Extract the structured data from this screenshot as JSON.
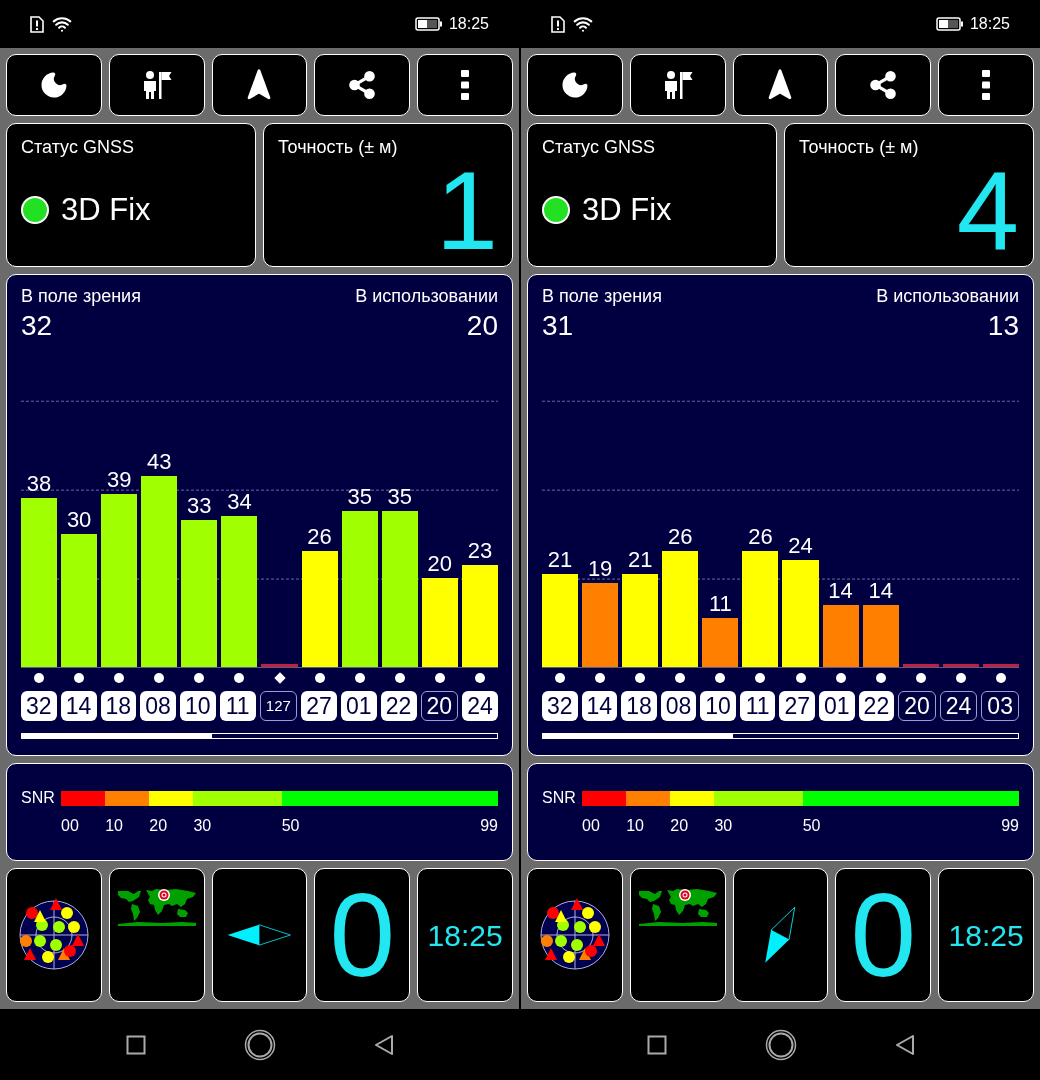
{
  "screens": [
    {
      "status_bar": {
        "time": "18:25"
      },
      "gnss_status": {
        "label": "Статус GNSS",
        "value": "3D Fix"
      },
      "accuracy": {
        "label": "Точность (± м)",
        "value": "1"
      },
      "satellites": {
        "in_view_label": "В поле зрения",
        "in_view": "32",
        "in_use_label": "В использовании",
        "in_use": "20",
        "chart_data": {
          "type": "bar",
          "categories": [
            "32",
            "14",
            "18",
            "08",
            "10",
            "11",
            "127",
            "27",
            "01",
            "22",
            "20",
            "24"
          ],
          "values": [
            38,
            30,
            39,
            43,
            33,
            34,
            0,
            26,
            35,
            35,
            20,
            23
          ],
          "value_labels": [
            "38",
            "30",
            "39",
            "43",
            "33",
            "34",
            null,
            "26",
            "35",
            "35",
            "20",
            "23"
          ]
        },
        "markers": [
          {
            "kind": "dot",
            "used": true
          },
          {
            "kind": "dot",
            "used": true
          },
          {
            "kind": "dot",
            "used": true
          },
          {
            "kind": "dot",
            "used": true
          },
          {
            "kind": "dot",
            "used": true
          },
          {
            "kind": "dot",
            "used": true
          },
          {
            "kind": "diamond",
            "used": false
          },
          {
            "kind": "dot",
            "used": true
          },
          {
            "kind": "dot",
            "used": true
          },
          {
            "kind": "dot",
            "used": true
          },
          {
            "kind": "dot",
            "used": false
          },
          {
            "kind": "dot",
            "used": true
          }
        ]
      },
      "snr_legend": {
        "label": "SNR",
        "segments": [
          {
            "color": "#ff0000"
          },
          {
            "color": "#ff8000"
          },
          {
            "color": "#ffff00"
          },
          {
            "color": "#a0ff00"
          },
          {
            "color": "#00ff00"
          }
        ],
        "ticks": [
          "00",
          "10",
          "20",
          "30",
          "50",
          "99"
        ]
      },
      "compass": {
        "kind": "pointing-left"
      },
      "speed": "0",
      "clock": "18:25"
    },
    {
      "status_bar": {
        "time": "18:25"
      },
      "gnss_status": {
        "label": "Статус GNSS",
        "value": "3D Fix"
      },
      "accuracy": {
        "label": "Точность (± м)",
        "value": "4"
      },
      "satellites": {
        "in_view_label": "В поле зрения",
        "in_view": "31",
        "in_use_label": "В использовании",
        "in_use": "13",
        "chart_data": {
          "type": "bar",
          "categories": [
            "32",
            "14",
            "18",
            "08",
            "10",
            "11",
            "27",
            "01",
            "22",
            "20",
            "24",
            "03"
          ],
          "values": [
            21,
            19,
            21,
            26,
            11,
            26,
            24,
            14,
            14,
            0,
            0,
            0
          ],
          "value_labels": [
            "21",
            "19",
            "21",
            "26",
            "11",
            "26",
            "24",
            "14",
            "14",
            null,
            null,
            null
          ]
        },
        "markers": [
          {
            "kind": "dot",
            "used": true
          },
          {
            "kind": "dot",
            "used": true
          },
          {
            "kind": "dot",
            "used": true
          },
          {
            "kind": "dot",
            "used": true
          },
          {
            "kind": "dot",
            "used": true
          },
          {
            "kind": "dot",
            "used": true
          },
          {
            "kind": "dot",
            "used": true
          },
          {
            "kind": "dot",
            "used": true
          },
          {
            "kind": "dot",
            "used": true
          },
          {
            "kind": "dot",
            "used": false
          },
          {
            "kind": "dot",
            "used": false
          },
          {
            "kind": "dot",
            "used": false
          }
        ]
      },
      "snr_legend": {
        "label": "SNR",
        "segments": [
          {
            "color": "#ff0000"
          },
          {
            "color": "#ff8000"
          },
          {
            "color": "#ffff00"
          },
          {
            "color": "#a0ff00"
          },
          {
            "color": "#00ff00"
          }
        ],
        "ticks": [
          "00",
          "10",
          "20",
          "30",
          "50",
          "99"
        ]
      },
      "compass": {
        "kind": "pointing-down-left"
      },
      "speed": "0",
      "clock": "18:25"
    }
  ]
}
